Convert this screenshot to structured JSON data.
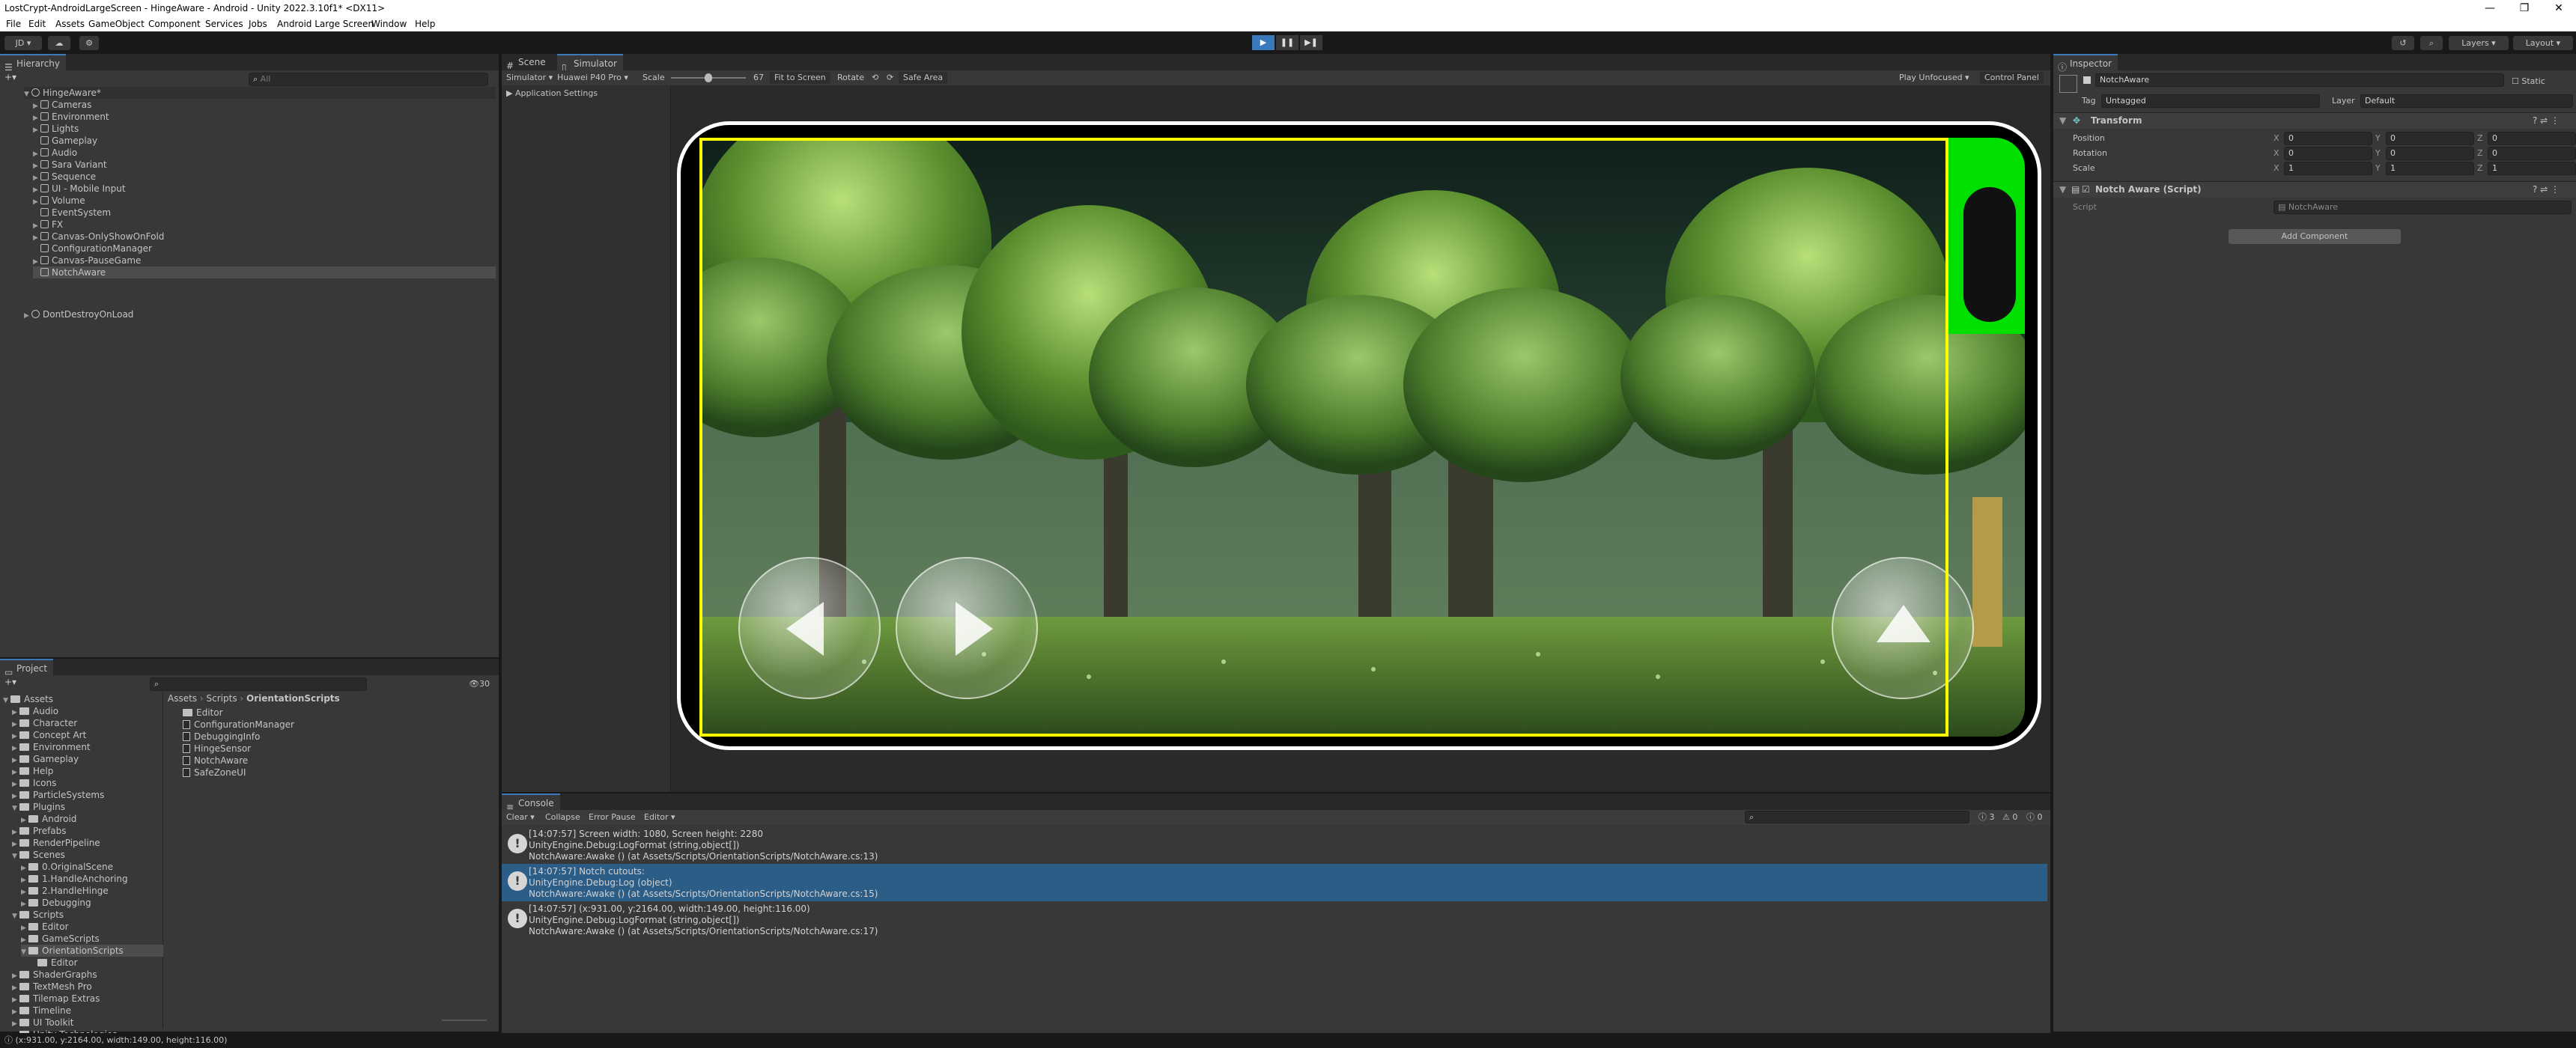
{
  "window": {
    "title": "LostCrypt-AndroidLargeScreen - HingeAware - Android - Unity 2022.3.10f1* <DX11>",
    "min": "—",
    "max": "❐",
    "close": "✕"
  },
  "menu": [
    "File",
    "Edit",
    "Assets",
    "GameObject",
    "Component",
    "Services",
    "Jobs",
    "Android Large Screen",
    "Window",
    "Help"
  ],
  "toolbar": {
    "account": "JD",
    "layers": "Layers",
    "layout": "Layout"
  },
  "hierarchy": {
    "tab": "Hierarchy",
    "search_placeholder": "All",
    "scene": "HingeAware*",
    "items": [
      "Cameras",
      "Environment",
      "Lights",
      "Gameplay",
      "Audio",
      "Sara Variant",
      "Sequence",
      "UI - Mobile Input",
      "Volume",
      "EventSystem",
      "FX",
      "Canvas-OnlyShowOnFold",
      "ConfigurationManager",
      "Canvas-PauseGame",
      "NotchAware"
    ],
    "ddol": "DontDestroyOnLoad"
  },
  "project": {
    "tab": "Project",
    "badge": "30",
    "tree": [
      {
        "label": "Assets",
        "depth": 0
      },
      {
        "label": "Audio",
        "depth": 1
      },
      {
        "label": "Character",
        "depth": 1
      },
      {
        "label": "Concept Art",
        "depth": 1
      },
      {
        "label": "Environment",
        "depth": 1
      },
      {
        "label": "Gameplay",
        "depth": 1
      },
      {
        "label": "Help",
        "depth": 1
      },
      {
        "label": "Icons",
        "depth": 1
      },
      {
        "label": "ParticleSystems",
        "depth": 1
      },
      {
        "label": "Plugins",
        "depth": 1
      },
      {
        "label": "Android",
        "depth": 2
      },
      {
        "label": "Prefabs",
        "depth": 1
      },
      {
        "label": "RenderPipeline",
        "depth": 1
      },
      {
        "label": "Scenes",
        "depth": 1
      },
      {
        "label": "0.OriginalScene",
        "depth": 2
      },
      {
        "label": "1.HandleAnchoring",
        "depth": 2
      },
      {
        "label": "2.HandleHinge",
        "depth": 2
      },
      {
        "label": "Debugging",
        "depth": 2
      },
      {
        "label": "Scripts",
        "depth": 1
      },
      {
        "label": "Editor",
        "depth": 2
      },
      {
        "label": "GameScripts",
        "depth": 2
      },
      {
        "label": "OrientationScripts",
        "depth": 2
      },
      {
        "label": "Editor",
        "depth": 3
      },
      {
        "label": "ShaderGraphs",
        "depth": 1
      },
      {
        "label": "TextMesh Pro",
        "depth": 1
      },
      {
        "label": "Tilemap Extras",
        "depth": 1
      },
      {
        "label": "Timeline",
        "depth": 1
      },
      {
        "label": "UI Toolkit",
        "depth": 1
      },
      {
        "label": "Unity Technologies",
        "depth": 1
      }
    ],
    "breadcrumb": [
      "Assets",
      "Scripts",
      "OrientationScripts"
    ],
    "files": [
      {
        "label": "Editor",
        "kind": "folder"
      },
      {
        "label": "ConfigurationManager",
        "kind": "script"
      },
      {
        "label": "DebuggingInfo",
        "kind": "script"
      },
      {
        "label": "HingeSensor",
        "kind": "script"
      },
      {
        "label": "NotchAware",
        "kind": "script"
      },
      {
        "label": "SafeZoneUI",
        "kind": "script"
      }
    ]
  },
  "scene_tabs": {
    "scene": "Scene",
    "simulator": "Simulator"
  },
  "simulator": {
    "mode": "Simulator",
    "device": "Huawei P40 Pro",
    "scale_label": "Scale",
    "scale_value": "67",
    "scale_fraction": 0.5,
    "fit": "Fit to Screen",
    "rotate": "Rotate",
    "safe_area": "Safe Area",
    "play_mode": "Play Unfocused",
    "control_panel": "Control Panel",
    "app_settings": "Application Settings"
  },
  "inspector": {
    "tab": "Inspector",
    "object_name": "NotchAware",
    "static": "Static",
    "tag_label": "Tag",
    "tag": "Untagged",
    "layer_label": "Layer",
    "layer": "Default",
    "transform": "Transform",
    "position": {
      "label": "Position",
      "x": "0",
      "y": "0",
      "z": "0"
    },
    "rotation": {
      "label": "Rotation",
      "x": "0",
      "y": "0",
      "z": "0"
    },
    "scale": {
      "label": "Scale",
      "x": "1",
      "y": "1",
      "z": "1"
    },
    "component": "Notch Aware (Script)",
    "script_label": "Script",
    "script_value": "NotchAware",
    "add_component": "Add Component",
    "axis_x": "X",
    "axis_y": "Y",
    "axis_z": "Z"
  },
  "console": {
    "tab": "Console",
    "clear": "Clear",
    "collapse": "Collapse",
    "error_pause": "Error Pause",
    "editor": "Editor",
    "count_info": "3",
    "count_warn": "0",
    "count_err": "0",
    "logs": [
      {
        "line1": "[14:07:57] Screen width: 1080, Screen height: 2280",
        "line2": "UnityEngine.Debug:LogFormat (string,object[])",
        "line3": "NotchAware:Awake () (at Assets/Scripts/OrientationScripts/NotchAware.cs:13)",
        "selected": false
      },
      {
        "line1": "[14:07:57] Notch cutouts:",
        "line2": "UnityEngine.Debug:Log (object)",
        "line3": "NotchAware:Awake () (at Assets/Scripts/OrientationScripts/NotchAware.cs:15)",
        "selected": true
      },
      {
        "line1": "[14:07:57] (x:931.00, y:2164.00, width:149.00, height:116.00)",
        "line2": "UnityEngine.Debug:LogFormat (string,object[])",
        "line3": "NotchAware:Awake () (at Assets/Scripts/OrientationScripts/NotchAware.cs:17)",
        "selected": false
      }
    ]
  },
  "status": "(x:931.00, y:2164.00, width:149.00, height:116.00)",
  "colors": {
    "accent": "#3a79bb",
    "safe_area": "#ffff00",
    "notch": "#00e000",
    "selection": "#2c5d87"
  }
}
